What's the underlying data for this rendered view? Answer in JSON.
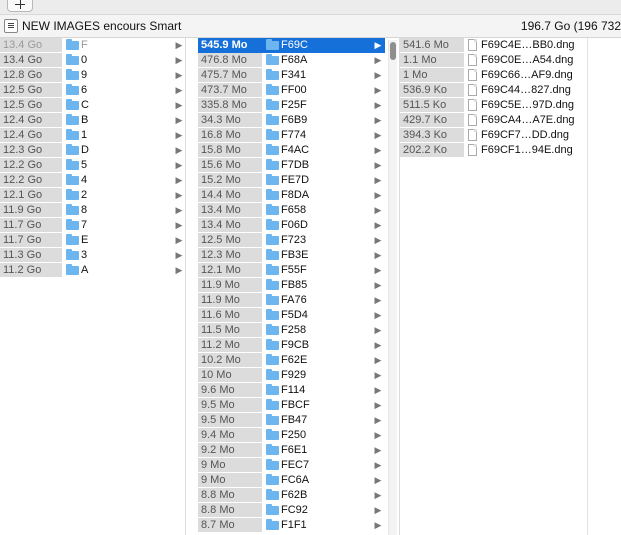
{
  "window": {
    "title": "NEW IMAGES encours Smart",
    "space_info": "196.7 Go (196 732"
  },
  "column1": {
    "items": [
      {
        "size": "13.4 Go",
        "name": "F",
        "state": "selected-inactive"
      },
      {
        "size": "13.4 Go",
        "name": "0"
      },
      {
        "size": "12.8 Go",
        "name": "9"
      },
      {
        "size": "12.5 Go",
        "name": "6"
      },
      {
        "size": "12.5 Go",
        "name": "C"
      },
      {
        "size": "12.4 Go",
        "name": "B"
      },
      {
        "size": "12.4 Go",
        "name": "1"
      },
      {
        "size": "12.3 Go",
        "name": "D"
      },
      {
        "size": "12.2 Go",
        "name": "5"
      },
      {
        "size": "12.2 Go",
        "name": "4"
      },
      {
        "size": "12.1 Go",
        "name": "2"
      },
      {
        "size": "11.9 Go",
        "name": "8"
      },
      {
        "size": "11.7 Go",
        "name": "7"
      },
      {
        "size": "11.7 Go",
        "name": "E"
      },
      {
        "size": "11.3 Go",
        "name": "3"
      },
      {
        "size": "11.2 Go",
        "name": "A"
      }
    ]
  },
  "column2": {
    "items": [
      {
        "size": "545.9 Mo",
        "name": "F69C",
        "state": "selected-active"
      },
      {
        "size": "476.8 Mo",
        "name": "F68A"
      },
      {
        "size": "475.7 Mo",
        "name": "F341"
      },
      {
        "size": "473.7 Mo",
        "name": "FF00"
      },
      {
        "size": "335.8 Mo",
        "name": "F25F"
      },
      {
        "size": "34.3 Mo",
        "name": "F6B9"
      },
      {
        "size": "16.8 Mo",
        "name": "F774"
      },
      {
        "size": "15.8 Mo",
        "name": "F4AC"
      },
      {
        "size": "15.6 Mo",
        "name": "F7DB"
      },
      {
        "size": "15.2 Mo",
        "name": "FE7D"
      },
      {
        "size": "14.4 Mo",
        "name": "F8DA"
      },
      {
        "size": "13.4 Mo",
        "name": "F658"
      },
      {
        "size": "13.4 Mo",
        "name": "F06D"
      },
      {
        "size": "12.5 Mo",
        "name": "F723"
      },
      {
        "size": "12.3 Mo",
        "name": "FB3E"
      },
      {
        "size": "12.1 Mo",
        "name": "F55F"
      },
      {
        "size": "11.9 Mo",
        "name": "FB85"
      },
      {
        "size": "11.9 Mo",
        "name": "FA76"
      },
      {
        "size": "11.6 Mo",
        "name": "F5D4"
      },
      {
        "size": "11.5 Mo",
        "name": "F258"
      },
      {
        "size": "11.2 Mo",
        "name": "F9CB"
      },
      {
        "size": "10.2 Mo",
        "name": "F62E"
      },
      {
        "size": "10 Mo",
        "name": "F929"
      },
      {
        "size": "9.6 Mo",
        "name": "F114"
      },
      {
        "size": "9.5 Mo",
        "name": "FBCF"
      },
      {
        "size": "9.5 Mo",
        "name": "FB47"
      },
      {
        "size": "9.4 Mo",
        "name": "F250"
      },
      {
        "size": "9.2 Mo",
        "name": "F6E1"
      },
      {
        "size": "9 Mo",
        "name": "FEC7"
      },
      {
        "size": "9 Mo",
        "name": "FC6A"
      },
      {
        "size": "8.8 Mo",
        "name": "F62B"
      },
      {
        "size": "8.8 Mo",
        "name": "FC92"
      },
      {
        "size": "8.7 Mo",
        "name": "F1F1"
      }
    ]
  },
  "column3": {
    "items": [
      {
        "size": "541.6 Mo",
        "name": "F69C4E…BB0.dng"
      },
      {
        "size": "1.1 Mo",
        "name": "F69C0E…A54.dng"
      },
      {
        "size": "1 Mo",
        "name": "F69C66…AF9.dng"
      },
      {
        "size": "536.9 Ko",
        "name": "F69C44…827.dng"
      },
      {
        "size": "511.5 Ko",
        "name": "F69C5E…97D.dng"
      },
      {
        "size": "429.7 Ko",
        "name": "F69CA4…A7E.dng"
      },
      {
        "size": "394.3 Ko",
        "name": "F69CF7…DD.dng"
      },
      {
        "size": "202.2 Ko",
        "name": "F69CF1…94E.dng"
      }
    ]
  },
  "icons": {
    "folder": "folder-icon",
    "file": "document-icon",
    "disclosure": "chevron-right-icon"
  },
  "colors": {
    "selection": "#1670d9",
    "folder": "#6cb5ef",
    "size_bar": "#dcdcdc"
  }
}
